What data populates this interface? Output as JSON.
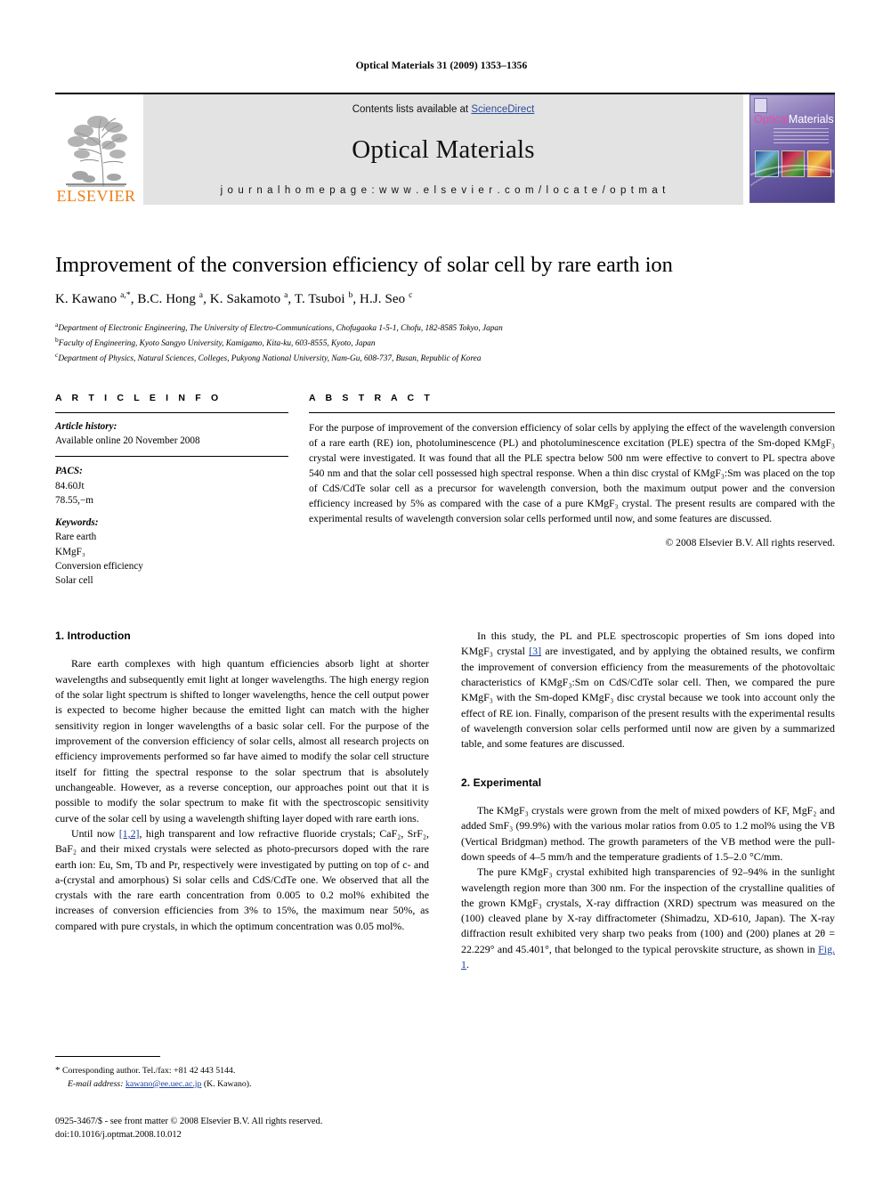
{
  "running_head": "Optical Materials 31 (2009) 1353–1356",
  "masthead": {
    "publisher": "ELSEVIER",
    "contents_prefix": "Contents lists available at ",
    "contents_link": "ScienceDirect",
    "journal_title": "Optical Materials",
    "homepage": "j o u r n a l   h o m e p a g e :   w w w . e l s e v i e r . c o m / l o c a t e / o p t m a t",
    "cover": {
      "title_part1": "Optical",
      "title_part2": "Materials"
    }
  },
  "article": {
    "title": "Improvement of the conversion efficiency of solar cell by rare earth ion",
    "authors_html": "K. Kawano <sup>a,*</sup>, B.C. Hong <sup>a</sup>, K. Sakamoto <sup>a</sup>, T. Tsuboi <sup>b</sup>, H.J. Seo <sup>c</sup>",
    "affiliations": [
      {
        "marker": "a",
        "text": "Department of Electronic Engineering, The University of Electro-Communications, Chofugaoka 1-5-1, Chofu, 182-8585 Tokyo, Japan"
      },
      {
        "marker": "b",
        "text": "Faculty of Engineering, Kyoto Sangyo University, Kamigamo, Kita-ku, 603-8555, Kyoto, Japan"
      },
      {
        "marker": "c",
        "text": "Department of Physics, Natural Sciences, Colleges, Pukyong National University, Nam-Gu, 608-737, Busan, Republic of Korea"
      }
    ]
  },
  "article_info": {
    "heading": "A R T I C L E   I N F O",
    "history_label": "Article history:",
    "history_value": "Available online 20 November 2008",
    "pacs_label": "PACS:",
    "pacs_values": [
      "84.60Jt",
      "78.55,−m"
    ],
    "keywords_label": "Keywords:",
    "keywords": [
      "Rare earth",
      "KMgF₃",
      "Conversion efficiency",
      "Solar cell"
    ]
  },
  "abstract": {
    "heading": "A B S T R A C T",
    "text": "For the purpose of improvement of the conversion efficiency of solar cells by applying the effect of the wavelength conversion of a rare earth (RE) ion, photoluminescence (PL) and photoluminescence excitation (PLE) spectra of the Sm-doped KMgF₃ crystal were investigated. It was found that all the PLE spectra below 500 nm were effective to convert to PL spectra above 540 nm and that the solar cell possessed high spectral response. When a thin disc crystal of KMgF₃:Sm was placed on the top of CdS/CdTe solar cell as a precursor for wavelength conversion, both the maximum output power and the conversion efficiency increased by 5% as compared with the case of a pure KMgF₃ crystal. The present results are compared with the experimental results of wavelength conversion solar cells performed until now, and some features are discussed.",
    "copyright": "© 2008 Elsevier B.V. All rights reserved."
  },
  "sections": {
    "intro_heading": "1. Introduction",
    "intro_p1": "Rare earth complexes with high quantum efficiencies absorb light at shorter wavelengths and subsequently emit light at longer wavelengths. The high energy region of the solar light spectrum is shifted to longer wavelengths, hence the cell output power is expected to become higher because the emitted light can match with the higher sensitivity region in longer wavelengths of a basic solar cell. For the purpose of the improvement of the conversion efficiency of solar cells, almost all research projects on efficiency improvements performed so far have aimed to modify the solar cell structure itself for fitting the spectral response to the solar spectrum that is absolutely unchangeable. However, as a reverse conception, our approaches point out that it is possible to modify the solar spectrum to make fit with the spectroscopic sensitivity curve of the solar cell by using a wavelength shifting layer doped with rare earth ions.",
    "intro_p2_a": "Until now ",
    "intro_p2_cite": "[1,2]",
    "intro_p2_b": ", high transparent and low refractive fluoride crystals; CaF₂, SrF₂, BaF₂ and their mixed crystals were selected as photo-precursors doped with the rare earth ion: Eu, Sm, Tb and Pr, respectively were investigated by putting on top of c- and a-(crystal and amorphous) Si solar cells and CdS/CdTe one. We observed that all the crystals with the rare earth concentration from 0.005 to 0.2 mol% exhibited the increases of conversion efficiencies from 3% to 15%, the maximum near 50%, as compared with pure crystals, in which the optimum concentration was 0.05 mol%.",
    "right_p1_a": "In this study, the PL and PLE spectroscopic properties of Sm ions doped into KMgF₃ crystal ",
    "right_p1_cite": "[3]",
    "right_p1_b": " are investigated, and by applying the obtained results, we confirm the improvement of conversion efficiency from the measurements of the photovoltaic characteristics of KMgF₃:Sm on CdS/CdTe solar cell. Then, we compared the pure KMgF₃ with the Sm-doped KMgF₃ disc crystal because we took into account only the effect of RE ion. Finally, comparison of the present results with the experimental results of wavelength conversion solar cells performed until now are given by a summarized table, and some features are discussed.",
    "exp_heading": "2. Experimental",
    "exp_p1": "The KMgF₃ crystals were grown from the melt of mixed powders of KF, MgF₂ and added SmF₃ (99.9%) with the various molar ratios from 0.05 to 1.2 mol% using the VB (Vertical Bridgman) method. The growth parameters of the VB method were the pull-down speeds of 4–5 mm/h and the temperature gradients of 1.5–2.0 °C/mm.",
    "exp_p2_a": "The pure KMgF₃ crystal exhibited high transparencies of 92–94% in the sunlight wavelength region more than 300 nm. For the inspection of the crystalline qualities of the grown KMgF₃ crystals, X-ray diffraction (XRD) spectrum was measured on the (100) cleaved plane by X-ray diffractometer (Shimadzu, XD-610, Japan). The X-ray diffraction result exhibited very sharp two peaks from (100) and (200) planes at 2θ = 22.229° and 45.401°, that belonged to the typical perovskite structure, as shown in ",
    "exp_p2_cite": "Fig. 1",
    "exp_p2_b": "."
  },
  "footnote": {
    "star": "*",
    "corresponding": "Corresponding author. Tel./fax: +81 42 443 5144.",
    "email_label": "E-mail address:",
    "email": "kawano@ee.uec.ac.jp",
    "email_suffix": " (K. Kawano)."
  },
  "footer": {
    "line1": "0925-3467/$ - see front matter © 2008 Elsevier B.V. All rights reserved.",
    "line2": "doi:10.1016/j.optmat.2008.10.012"
  }
}
